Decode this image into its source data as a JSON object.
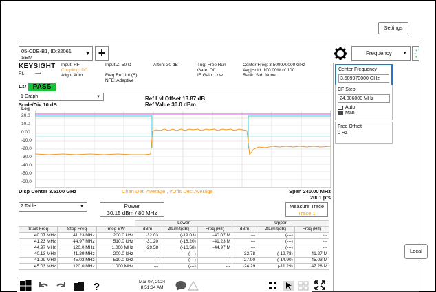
{
  "instrument": {
    "name_line1": "05-CDE-B1, ID:32061",
    "name_line2": "SEM"
  },
  "header": {
    "brand": "KEYSIGHT",
    "input": "Input: RF",
    "coupling": "Coupling: DC",
    "align": "Align: Auto",
    "rl": "RL",
    "input_z": "Input Z: 50 Ω",
    "freq_ref": "Freq Ref: Int (S)",
    "nfe": "NFE: Adaptive",
    "atten": "Atten: 30 dB",
    "trig": "Trig: Free Run",
    "gate": "Gate: Off",
    "if_gain": "IF Gain: Low",
    "center_freq": "Center Freq: 3.509970000 GHz",
    "avg_hold": "Avg|Hold: 100.00% of 100",
    "radio_std": "Radio Std: None",
    "lxi": "LXI",
    "pass": "PASS"
  },
  "measure_menu": {
    "selected": "Frequency"
  },
  "graph": {
    "selector": "1 Graph",
    "scale": "Scale/Div 10 dB",
    "ref_offset": "Ref Lvl Offset 13.87 dB",
    "ref_value": "Ref Value 30.0 dBm",
    "log": "Log",
    "y_ticks": [
      "20.0",
      "10.0",
      "0.00",
      "-10.0",
      "-20.0",
      "-30.0",
      "-40.0",
      "-50.0",
      "-60.0"
    ],
    "disp_center": "Disp Center 3.5100 GHz",
    "chan_det": "Chan Det: Average , #Offs Det: Average",
    "span": "Span 240.00 MHz",
    "points": "2001 pts",
    "colors": {
      "trace": "#f29a1e",
      "limit": "#e04ee0",
      "channel": "#2fd3e3"
    }
  },
  "table_area": {
    "selector": "2 Table",
    "power_label": "Power",
    "power_value": "30.15 dBm / 80 MHz",
    "measure_trace_label": "Measure Trace",
    "measure_trace_value": "Trace 1",
    "group_lower": "Lower",
    "group_upper": "Upper",
    "columns": [
      "Start Freq",
      "Stop Freq",
      "Integ BW",
      "dBm",
      "ΔLimit(dB)",
      "Freq (Hz)",
      "dBm",
      "ΔLimit(dB)",
      "Freq (Hz)"
    ],
    "rows": [
      [
        "40.07 MHz",
        "41.23 MHz",
        "200.0 kHz",
        "-32.03",
        "(-19.03)",
        "-40.07 M",
        "---",
        "(---)",
        "---"
      ],
      [
        "41.23 MHz",
        "44.97 MHz",
        "510.0 kHz",
        "-31.20",
        "(-18.20)",
        "-41.23 M",
        "---",
        "(---)",
        "---"
      ],
      [
        "44.97 MHz",
        "120.0 MHz",
        "1.000 MHz",
        "-29.58",
        "(-16.58)",
        "-44.97 M",
        "---",
        "(---)",
        "---"
      ],
      [
        "40.13 MHz",
        "41.29 MHz",
        "200.0 kHz",
        "---",
        "(---)",
        "---",
        "-32.78",
        "(-19.78)",
        "41.27 M"
      ],
      [
        "41.29 MHz",
        "45.03 MHz",
        "510.0 kHz",
        "---",
        "(---)",
        "---",
        "-27.90",
        "(-14.90)",
        "45.03 M"
      ],
      [
        "45.03 MHz",
        "120.0 MHz",
        "1.000 MHz",
        "---",
        "(---)",
        "---",
        "-24.29",
        "(-11.29)",
        "47.28 M"
      ]
    ]
  },
  "softkeys": {
    "center_frequency_label": "Center Frequency",
    "center_frequency_value": "3.509970000 GHz",
    "cf_step_label": "CF Step",
    "cf_step_value": "24.006000 MHz",
    "auto": "Auto",
    "man": "Man",
    "freq_offset_label": "Freq Offset",
    "freq_offset_value": "0 Hz",
    "settings": "Settings",
    "local": "Local"
  },
  "taskbar": {
    "date": "Mar 07, 2024",
    "time": "8:51:34 AM"
  }
}
